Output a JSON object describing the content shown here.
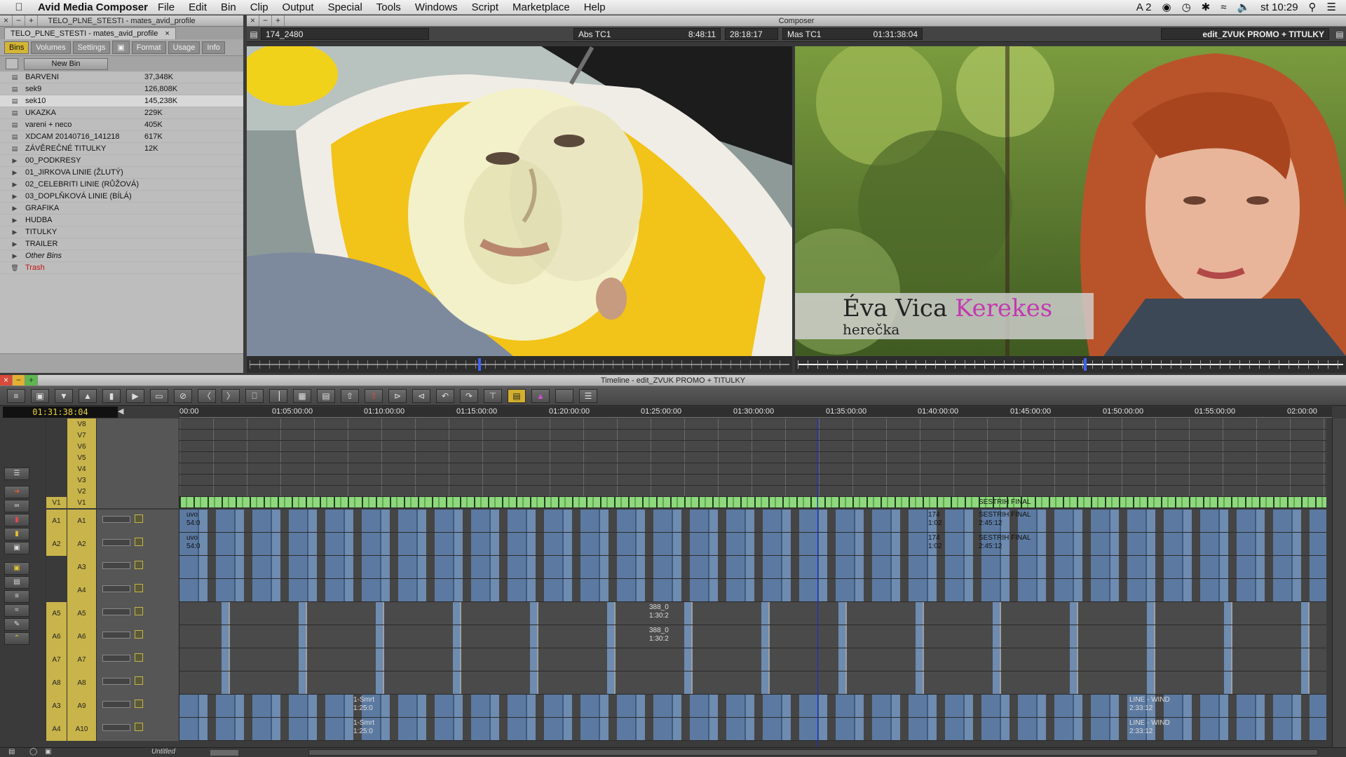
{
  "menubar": {
    "app_name": "Avid Media Composer",
    "items": [
      "File",
      "Edit",
      "Bin",
      "Clip",
      "Output",
      "Special",
      "Tools",
      "Windows",
      "Script",
      "Marketplace",
      "Help"
    ],
    "status_a2": "A 2",
    "time": "st 10:29"
  },
  "project": {
    "window_title": "TELO_PLNE_STESTI - mates_avid_profile",
    "tab_label": "TELO_PLNE_STESTI - mates_avid_profile",
    "tabs": [
      "Bins",
      "Volumes",
      "Settings",
      "",
      "Format",
      "Usage",
      "Info"
    ],
    "new_bin": "New Bin",
    "bins": [
      {
        "name": "BARVENI",
        "size": "37,348K",
        "type": "bin"
      },
      {
        "name": "sek9",
        "size": "126,808K",
        "type": "bin"
      },
      {
        "name": "sek10",
        "size": "145,238K",
        "type": "bin",
        "selected": true
      },
      {
        "name": "UKAZKA",
        "size": "229K",
        "type": "bin"
      },
      {
        "name": "vareni + neco",
        "size": "405K",
        "type": "bin"
      },
      {
        "name": "XDCAM 20140716_141218",
        "size": "617K",
        "type": "bin"
      },
      {
        "name": "ZÁVĚREČNÉ TITULKY",
        "size": "12K",
        "type": "bin"
      },
      {
        "name": "00_PODKRESY",
        "size": "",
        "type": "folder"
      },
      {
        "name": "01_JIRKOVA LINIE (ŽLUTÝ)",
        "size": "",
        "type": "folder"
      },
      {
        "name": "02_CELEBRITI LINIE (RŮŽOVÁ)",
        "size": "",
        "type": "folder"
      },
      {
        "name": "03_DOPLŇKOVÁ LINIE (BÍLÁ)",
        "size": "",
        "type": "folder"
      },
      {
        "name": "GRAFIKA",
        "size": "",
        "type": "folder"
      },
      {
        "name": "HUDBA",
        "size": "",
        "type": "folder"
      },
      {
        "name": "TITULKY",
        "size": "",
        "type": "folder"
      },
      {
        "name": "TRAILER",
        "size": "",
        "type": "folder"
      },
      {
        "name": "Other Bins",
        "size": "",
        "type": "other"
      },
      {
        "name": "Trash",
        "size": "",
        "type": "trash"
      }
    ]
  },
  "composer": {
    "window_title": "Composer",
    "clip_name": "174_2480",
    "abs_label": "Abs TC1",
    "abs_value": "8:48:11",
    "duration": "28:18:17",
    "mas_label": "Mas TC1",
    "mas_value": "01:31:38:04",
    "sequence_name": "edit_ZVUK PROMO + TITULKY",
    "lower_third_first": "Éva Vica ",
    "lower_third_last": "Kerekes",
    "lower_third_role": "herečka"
  },
  "timeline": {
    "window_title": "Timeline - edit_ZVUK PROMO + TITULKY",
    "timecode": "01:31:38:04",
    "ruler": [
      "00:00",
      "01:05:00:00",
      "01:10:00:00",
      "01:15:00:00",
      "01:20:00:00",
      "01:25:00:00",
      "01:30:00:00",
      "01:35:00:00",
      "01:40:00:00",
      "01:45:00:00",
      "01:50:00:00",
      "01:55:00:00",
      "02:00:00"
    ],
    "video_tracks": [
      "V8",
      "V7",
      "V6",
      "V5",
      "V4",
      "V3",
      "V2",
      "V1"
    ],
    "audio_tracks": [
      {
        "src": "A1",
        "rec": "A1"
      },
      {
        "src": "A2",
        "rec": "A2"
      },
      {
        "src": "",
        "rec": "A3"
      },
      {
        "src": "",
        "rec": "A4"
      },
      {
        "src": "A5",
        "rec": "A5"
      },
      {
        "src": "A6",
        "rec": "A6"
      },
      {
        "src": "A7",
        "rec": "A7"
      },
      {
        "src": "A8",
        "rec": "A8"
      },
      {
        "src": "A3",
        "rec": "A9"
      },
      {
        "src": "A4",
        "rec": "A10"
      }
    ],
    "v1_src": "V1",
    "clip_labels": {
      "sestrih": "SESTRIH FINAL",
      "sestrih_tc": "2:45:12",
      "line_wind": "LINE - WIND",
      "line_wind_tc": "2:33:12",
      "c388": "388_0",
      "c388_tc": "1:30:2",
      "uvod": "uvo",
      "uvod_tc": "54:0",
      "c174": "174",
      "c174_tc": "1:02",
      "smrt": "1-Smrt",
      "smrt_tc": "1:25:0"
    },
    "bottom_label": "Untitled"
  }
}
